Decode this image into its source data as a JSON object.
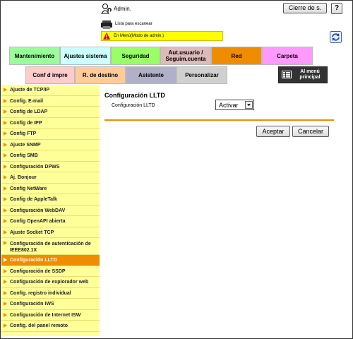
{
  "header": {
    "user_label": "Admin.",
    "logout_label": "Cierre de s.",
    "help_label": "?",
    "status_text": "Lista para escanear",
    "mode_text": "En Menú(Modo de admin.)"
  },
  "tabs_row1": [
    {
      "label": "Mantenimiento",
      "bg": "#99ff99"
    },
    {
      "label": "Ajustes sistema",
      "bg": "#ccffff"
    },
    {
      "label": "Seguridad",
      "bg": "#99ff66"
    },
    {
      "label": "Aut.usuario / Seguim.cuenta",
      "bg": "#ddbbbb"
    },
    {
      "label": "Red",
      "bg": "#f08c00"
    },
    {
      "label": "Carpeta",
      "bg": "#ff99ff"
    }
  ],
  "tabs_row2": [
    {
      "label": "Conf d impre",
      "bg": "#ffcccc"
    },
    {
      "label": "R. de destino",
      "bg": "#ffcc99"
    },
    {
      "label": "Asistente",
      "bg": "#b0b0c8"
    },
    {
      "label": "Personalizar",
      "bg": "#d0d0d0"
    }
  ],
  "main_menu_label": "Al menú principal",
  "sidebar": {
    "items": [
      {
        "label": "Ajuste de TCP/IP"
      },
      {
        "label": "Config. E-mail"
      },
      {
        "label": "Config de LDAP"
      },
      {
        "label": "Config de IPP"
      },
      {
        "label": "Config FTP"
      },
      {
        "label": "Ajuste SNMP"
      },
      {
        "label": "Config SMB"
      },
      {
        "label": "Configuración DPWS"
      },
      {
        "label": "Aj. Bonjour"
      },
      {
        "label": "Config NetWare"
      },
      {
        "label": "Config de AppleTalk"
      },
      {
        "label": "Configuración WebDAV"
      },
      {
        "label": "Config OpenAPI abierta"
      },
      {
        "label": "Ajuste Socket TCP"
      },
      {
        "label": "Configuración de autenticación de IEEE802.1X"
      },
      {
        "label": "Configuración LLTD"
      },
      {
        "label": "Configuración de SSDP"
      },
      {
        "label": "Configuración de explorador web"
      },
      {
        "label": "Config. registro individual"
      },
      {
        "label": "Configuración IWS"
      },
      {
        "label": "Configuración de Internet ISW"
      },
      {
        "label": "Config. del panel remoto"
      }
    ]
  },
  "main": {
    "section_title": "Configuración LLTD",
    "field_label": "Configuración LLTD",
    "select_value": "Activar",
    "ok_label": "Aceptar",
    "cancel_label": "Cancelar"
  }
}
